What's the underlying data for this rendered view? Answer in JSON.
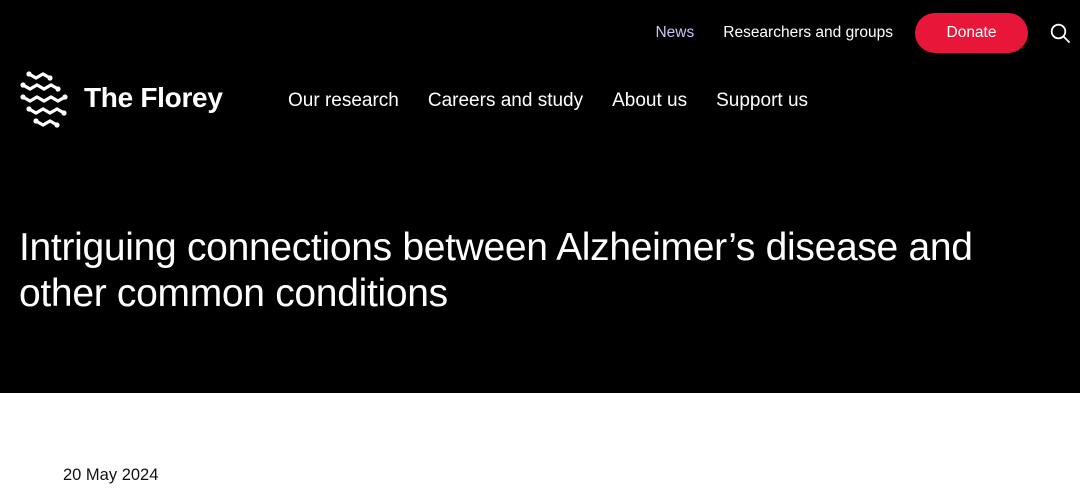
{
  "utility_nav": {
    "news": "News",
    "researchers": "Researchers and groups",
    "donate": "Donate",
    "search_icon": "search-icon"
  },
  "brand": {
    "name": "The Florey",
    "logo_icon": "florey-molecule-logo"
  },
  "main_nav": {
    "items": [
      {
        "label": "Our research"
      },
      {
        "label": "Careers and study"
      },
      {
        "label": "About us"
      },
      {
        "label": "Support us"
      }
    ]
  },
  "article": {
    "title": "Intriguing connections between Alzheimer’s disease and other common conditions",
    "date": "20 May 2024"
  },
  "colors": {
    "hero_bg": "#000000",
    "donate": "#e8173a",
    "active_link": "#c9c5f5"
  }
}
